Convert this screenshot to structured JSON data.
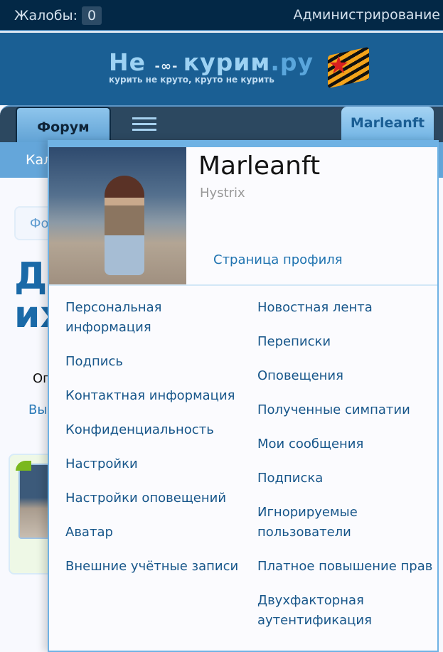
{
  "topbar": {
    "reports_label": "Жалобы:",
    "reports_count": "0",
    "admin_label": "Администрирование"
  },
  "logo": {
    "title_main": "Не ",
    "title_knot": "-∞- ",
    "title_kurim": "курим",
    "title_domain": ".ру",
    "slogan": "курить не круто, круто не курить"
  },
  "nav": {
    "forum_tab": "Форум",
    "user_tab": "Marleanft",
    "subnav_partial": "Кал"
  },
  "background": {
    "breadcrumb_partial": "Фо",
    "title_partial_line1": "Д",
    "title_partial_line2": "их",
    "text_partial": "Оп",
    "link_partial": "Вы"
  },
  "panel": {
    "username": "Marleanft",
    "user_title": "Hystrix",
    "profile_link": "Страница профиля",
    "left_items": [
      "Персональная информация",
      "Подпись",
      "Контактная информация",
      "Конфиденциальность",
      "Настройки",
      "Настройки оповещений",
      "Аватар",
      "Внешние учётные записи"
    ],
    "right_items": [
      "Новостная лента",
      "Переписки",
      "Оповещения",
      "Полученные симпатии",
      "Мои сообщения",
      "Подписка",
      "Игнорируемые пользователи",
      "Платное повышение прав",
      "Двухфакторная аутентификация"
    ]
  },
  "colors": {
    "topbar": "#032846",
    "header": "#1a5f94",
    "accent": "#6fb2e4",
    "link": "#17568a"
  }
}
